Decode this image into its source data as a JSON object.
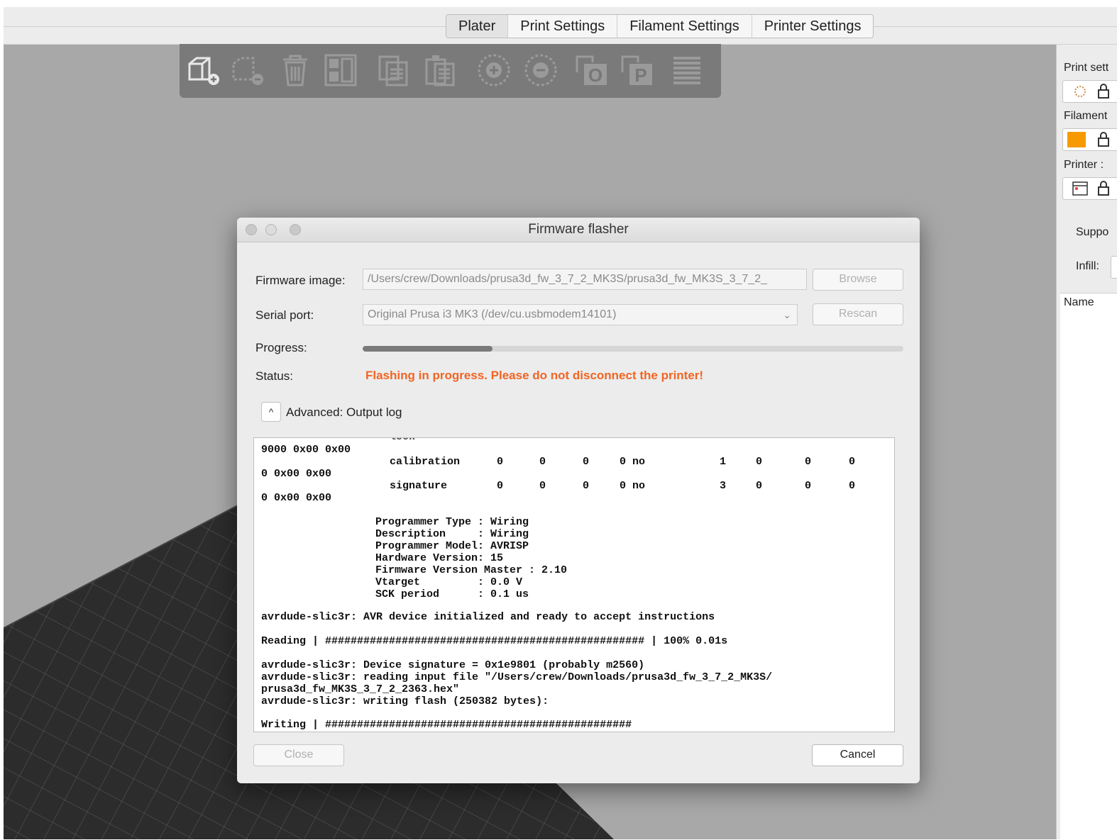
{
  "tabs": [
    "Plater",
    "Print Settings",
    "Filament Settings",
    "Printer Settings"
  ],
  "active_tab": "Plater",
  "toolbar": {
    "icons": [
      "add-object-icon",
      "delete-icon",
      "delete-all-icon",
      "arrange-icon",
      "copy-icon",
      "paste-icon",
      "add-instance-icon",
      "remove-instance-icon",
      "split-objects-icon",
      "split-parts-icon",
      "layers-editing-icon"
    ],
    "o_glyph": "O",
    "p_glyph": "P"
  },
  "right_panel": {
    "print_settings_label": "Print sett",
    "filament_label": "Filament",
    "printer_label": "Printer :",
    "supports_label": "Suppo",
    "infill_label": "Infill:",
    "name_header": "Name",
    "filament_color": "#f79a00"
  },
  "dialog": {
    "title": "Firmware flasher",
    "firmware_image_label": "Firmware image:",
    "firmware_image_value": "/Users/crew/Downloads/prusa3d_fw_3_7_2_MK3S/prusa3d_fw_MK3S_3_7_2_",
    "browse_label": "Browse",
    "serial_port_label": "Serial port:",
    "serial_port_value": "Original Prusa i3 MK3 (/dev/cu.usbmodem14101)",
    "rescan_label": "Rescan",
    "progress_label": "Progress:",
    "progress_fraction": 0.24,
    "status_label": "Status:",
    "status_text": "Flashing in progress. Please do not disconnect the printer!",
    "status_color": "#f26522",
    "advanced_label": "Advanced: Output log",
    "close_label": "Close",
    "cancel_label": "Cancel"
  },
  "log": {
    "left_col": [
      "9000 0x00 0x00",
      "0 0x00 0x00",
      "0 0x00 0x00"
    ],
    "clipped_row": "lock",
    "memory_rows": [
      {
        "name": "calibration",
        "c1": "0",
        "c2": "0",
        "c3": "0",
        "c4": "0 no",
        "c5": "1",
        "c6": "0",
        "c7": "0",
        "c8": "0"
      },
      {
        "name": "signature",
        "c1": "0",
        "c2": "0",
        "c3": "0",
        "c4": "0 no",
        "c5": "3",
        "c6": "0",
        "c7": "0",
        "c8": "0"
      }
    ],
    "programmer_lines": [
      "Programmer Type : Wiring",
      "Description     : Wiring",
      "Programmer Model: AVRISP",
      "Hardware Version: 15",
      "Firmware Version Master : 2.10",
      "Vtarget         : 0.0 V",
      "SCK period      : 0.1 us"
    ],
    "init_line": "avrdude-slic3r: AVR device initialized and ready to accept instructions",
    "reading_line": "Reading | ################################################## | 100% 0.01s",
    "device_lines": [
      "avrdude-slic3r: Device signature = 0x1e9801 (probably m2560)",
      "avrdude-slic3r: reading input file \"/Users/crew/Downloads/prusa3d_fw_3_7_2_MK3S/",
      "prusa3d_fw_MK3S_3_7_2_2363.hex\"",
      "avrdude-slic3r: writing flash (250382 bytes):"
    ],
    "writing_line": "Writing | ################################################"
  }
}
